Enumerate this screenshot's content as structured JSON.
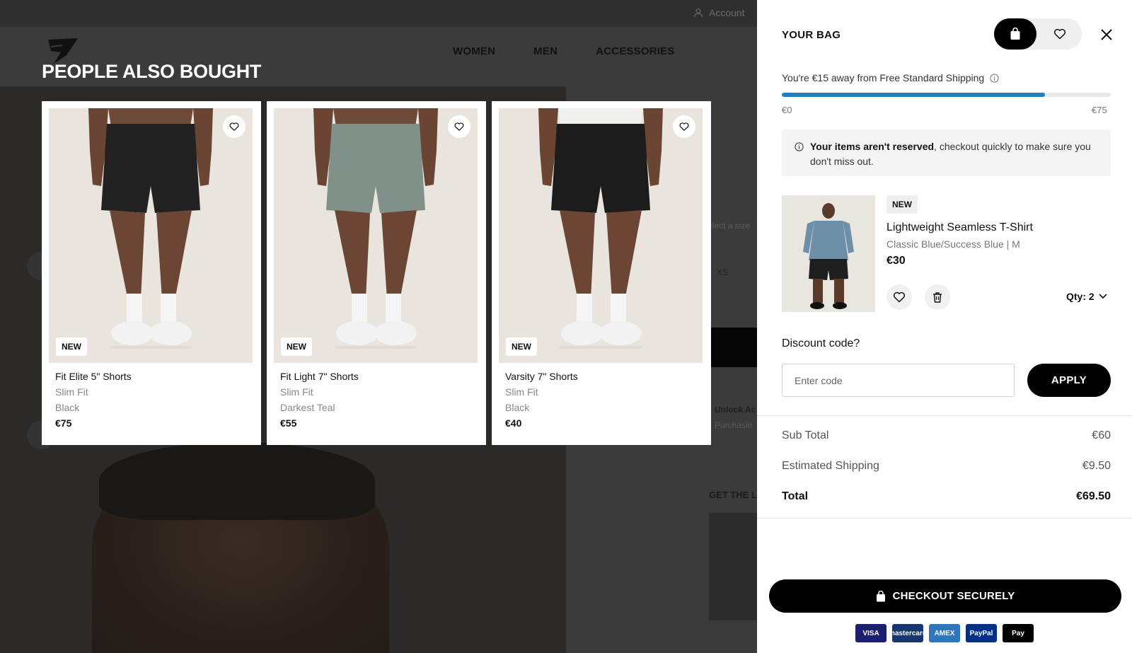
{
  "background": {
    "account_label": "Account",
    "nav": [
      "WOMEN",
      "MEN",
      "ACCESSORIES"
    ],
    "select_size": "elect a size",
    "size_xs": "XS",
    "unlock": "Unlock Ac",
    "purchasing": "Purchasin",
    "get_the": "GET THE L"
  },
  "people_also_bought": {
    "title": "PEOPLE ALSO BOUGHT",
    "products": [
      {
        "badge": "NEW",
        "name": "Fit Elite 5\" Shorts",
        "fit": "Slim Fit",
        "color": "Black",
        "price": "€75",
        "short_color": "#222222",
        "shirt": false
      },
      {
        "badge": "NEW",
        "name": "Fit Light 7\" Shorts",
        "fit": "Slim Fit",
        "color": "Darkest Teal",
        "price": "€55",
        "short_color": "#7f9189",
        "shirt": false
      },
      {
        "badge": "NEW",
        "name": "Varsity 7\" Shorts",
        "fit": "Slim Fit",
        "color": "Black",
        "price": "€40",
        "short_color": "#1c1c1c",
        "shirt": true
      }
    ]
  },
  "bag": {
    "title": "YOUR BAG",
    "shipping_message": "You're €15 away from Free Standard Shipping",
    "progress_fraction": 0.8,
    "progress_min": "€0",
    "progress_max": "€75",
    "notice_bold": "Your items aren't reserved",
    "notice_rest": ", checkout quickly to make sure you don't miss out.",
    "item": {
      "badge": "NEW",
      "name": "Lightweight Seamless T-Shirt",
      "variant": "Classic Blue/Success Blue | M",
      "price": "€30",
      "qty_label": "Qty: 2"
    },
    "discount_label": "Discount code?",
    "discount_placeholder": "Enter code",
    "apply_label": "APPLY",
    "subtotal_label": "Sub Total",
    "subtotal_value": "€60",
    "shipping_label": "Estimated Shipping",
    "shipping_value": "€9.50",
    "total_label": "Total",
    "total_value": "€69.50",
    "checkout_label": "CHECKOUT SECURELY",
    "payments": [
      {
        "name": "VISA",
        "bg": "#1a1f71"
      },
      {
        "name": "mastercard",
        "bg": "#16366f"
      },
      {
        "name": "AMEX",
        "bg": "#2e77bc"
      },
      {
        "name": "PayPal",
        "bg": "#003087"
      },
      {
        "name": "Pay",
        "bg": "#000000"
      }
    ]
  },
  "colors": {
    "progress": "#1d7fc4",
    "overlay_bg": "#3a3a3a",
    "card_bg": "#ffffff"
  }
}
